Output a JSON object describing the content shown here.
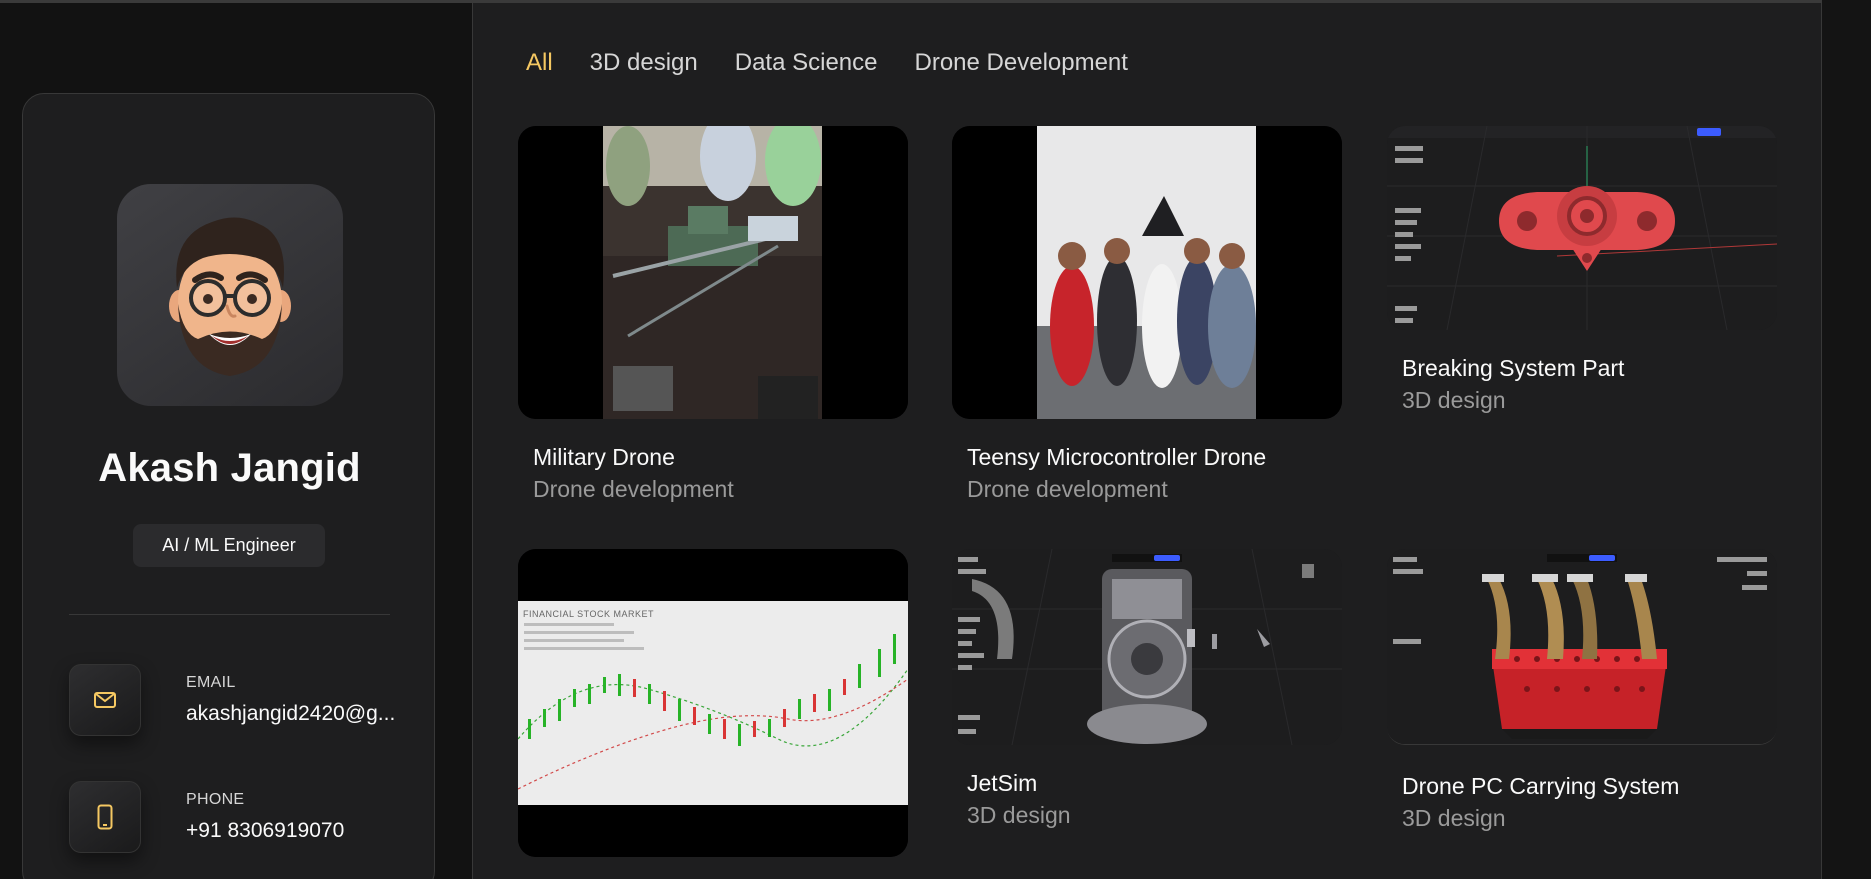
{
  "profile": {
    "name": "Akash Jangid",
    "role": "AI / ML Engineer",
    "contacts": [
      {
        "label": "EMAIL",
        "value": "akashjangid2420@g...",
        "icon": "mail-icon"
      },
      {
        "label": "PHONE",
        "value": "+91 8306919070",
        "icon": "phone-icon"
      }
    ]
  },
  "filters": [
    {
      "label": "All",
      "active": true
    },
    {
      "label": "3D design",
      "active": false
    },
    {
      "label": "Data Science",
      "active": false
    },
    {
      "label": "Drone Development",
      "active": false
    }
  ],
  "projects": [
    {
      "title": "Military Drone",
      "category": "Drone development",
      "thumb": "photo"
    },
    {
      "title": "Teensy Microcontroller Drone",
      "category": "Drone development",
      "thumb": "photo"
    },
    {
      "title": "Breaking System Part",
      "category": "3D design",
      "thumb": "cad-render"
    },
    {
      "title": "",
      "category": "",
      "thumb": "stock-chart"
    },
    {
      "title": "JetSim",
      "category": "3D design",
      "thumb": "cad-render"
    },
    {
      "title": "Drone PC Carrying System",
      "category": "3D design",
      "thumb": "cad-render"
    }
  ],
  "thumb_text": {
    "stock_chart_heading": "FINANCIAL  STOCK  MARKET"
  },
  "colors": {
    "accent": "#f5c862",
    "background": "#121212",
    "panel": "#1e1e1f",
    "muted_text": "#9a9a9a",
    "cad_part_red": "#e0494d"
  }
}
